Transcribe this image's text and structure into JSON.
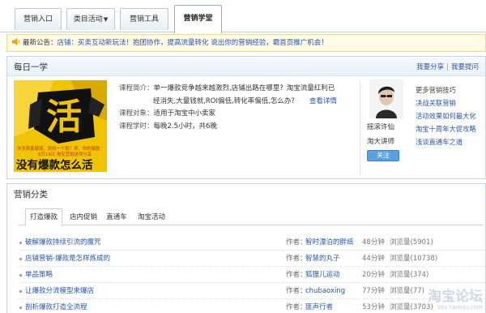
{
  "tabs": [
    {
      "label": "营销入口"
    },
    {
      "label": "类目活动",
      "caret": "▼"
    },
    {
      "label": "营销工具"
    },
    {
      "label": "营销学堂"
    }
  ],
  "notice": {
    "label": "最新公告：",
    "text1": "店铺：买卖互动新玩法！抱团协作，提高流量转化 说出你的营销经验，",
    "text2": "霸首页推广机会！"
  },
  "daily": {
    "title": "每日一学",
    "share": "我要分享",
    "sep": "|",
    "ask": "我要提问",
    "cover": {
      "big_char": "活",
      "line1": "许多卖家疑惑，卖的一个款？卖，你的爆款",
      "line2": "8月19日 淘宝营销讲师分享",
      "slogan": "没有爆款怎么活"
    },
    "course": {
      "intro_label": "课程简介：",
      "intro_text1": "单一爆款竞争越来越激烈,店铺出路在哪里？淘宝流量红利已",
      "intro_text2": "经消失,大量钱就,ROI偏低,转化率偏低,怎么办？",
      "more": "查看详情",
      "audience_label": "课程对象：",
      "audience": "适用于淘宝中小卖家",
      "time_label": "课程学时：",
      "time": "每晚2.5小时，共6晚"
    },
    "lecturer": {
      "name": "摇滚许仙",
      "role": "淘大讲师",
      "follow": "关注"
    },
    "tips": {
      "title": "更多营销技巧",
      "links": [
        "决战关联营销",
        "活动效果如何最大化",
        "淘宝十周年大促攻略",
        "浅谈直通车之道"
      ]
    }
  },
  "category": {
    "title": "营销分类",
    "subtabs": [
      "打造爆款",
      "店内促销",
      "直通车",
      "淘宝活动"
    ],
    "by_label": "作者：",
    "articles": [
      {
        "title": "破解爆款持续引流的魔咒",
        "author": "智时漂泊的胖纸",
        "duration": "48分钟",
        "views": "浏览量(5901)"
      },
      {
        "title": "店铺营销-爆款是怎样炼成的",
        "author": "智慧的丸子",
        "duration": "44分钟",
        "views": "浏览量(10738)"
      },
      {
        "title": "单品策略",
        "author": "狐狸儿运动",
        "duration": "20分钟",
        "views": "浏览量(374)"
      },
      {
        "title": "让爆款分流模型来爆店",
        "author": "chubaoxing",
        "duration": "77分钟",
        "views": "浏览量(77)"
      },
      {
        "title": "剖析爆款打造全流程",
        "author": "匪声行者",
        "duration": "53分钟",
        "views": "浏览量(3703)"
      }
    ]
  },
  "watermark": {
    "big": "淘宝论坛",
    "small": "bbs.taobao.com"
  }
}
